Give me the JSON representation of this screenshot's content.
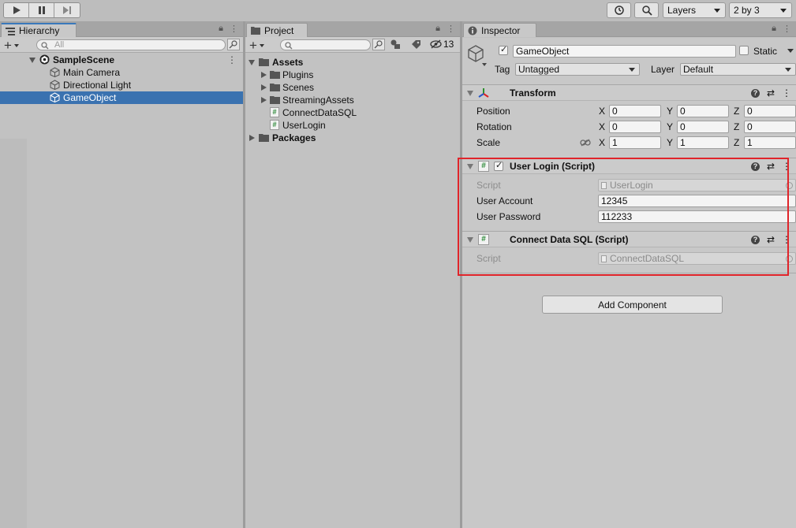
{
  "toolbar": {
    "layers_label": "Layers",
    "layout_label": "2 by 3"
  },
  "hierarchy": {
    "tab_label": "Hierarchy",
    "search_placeholder": "All",
    "items": [
      {
        "label": "SampleScene"
      },
      {
        "label": "Main Camera"
      },
      {
        "label": "Directional Light"
      },
      {
        "label": "GameObject"
      }
    ]
  },
  "project": {
    "tab_label": "Project",
    "hidden_count": "13",
    "items": [
      {
        "label": "Assets"
      },
      {
        "label": "Plugins"
      },
      {
        "label": "Scenes"
      },
      {
        "label": "StreamingAssets"
      },
      {
        "label": "ConnectDataSQL"
      },
      {
        "label": "UserLogin"
      },
      {
        "label": "Packages"
      }
    ]
  },
  "inspector": {
    "tab_label": "Inspector",
    "object_name": "GameObject",
    "static_label": "Static",
    "tag_label": "Tag",
    "tag_value": "Untagged",
    "layer_label": "Layer",
    "layer_value": "Default",
    "transform": {
      "title": "Transform",
      "rows": [
        {
          "label": "Position",
          "x": "0",
          "y": "0",
          "z": "0"
        },
        {
          "label": "Rotation",
          "x": "0",
          "y": "0",
          "z": "0"
        },
        {
          "label": "Scale",
          "x": "1",
          "y": "1",
          "z": "1"
        }
      ],
      "axis": {
        "x": "X",
        "y": "Y",
        "z": "Z"
      }
    },
    "user_login": {
      "title": "User Login (Script)",
      "script_label": "Script",
      "script_value": "UserLogin",
      "account_label": "User Account",
      "account_value": "12345",
      "password_label": "User Password",
      "password_value": "112233"
    },
    "connect_sql": {
      "title": "Connect Data SQL (Script)",
      "script_label": "Script",
      "script_value": "ConnectDataSQL"
    },
    "add_component_label": "Add Component"
  },
  "colors": {
    "selection": "#3a72b0",
    "highlight_box": "#e0242a",
    "script_hash": "#2e8b3a"
  }
}
